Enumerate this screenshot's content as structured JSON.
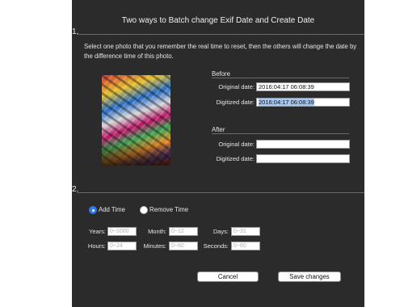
{
  "dialog": {
    "title": "Two ways to Batch change Exif Date and Create Date",
    "section1_number": "1.",
    "section2_number": "2.",
    "description": "Select one photo that you remember the real time to reset, then the others will change the date by the difference time of this photo."
  },
  "before": {
    "heading": "Before",
    "original_label": "Original date:",
    "original_value": "2016:04:17 06:08:39",
    "digitized_label": "Digitized date:",
    "digitized_value": "2016:04:17 06:08:39"
  },
  "after": {
    "heading": "After",
    "original_label": "Original date:",
    "original_value": "",
    "digitized_label": "Digitized date:",
    "digitized_value": ""
  },
  "mode": {
    "add_label": "Add Time",
    "remove_label": "Remove Time",
    "selected": "add"
  },
  "time_fields": {
    "years_label": "Years:",
    "years_placeholder": "0~1000",
    "month_label": "Month:",
    "month_placeholder": "0~12",
    "days_label": "Days:",
    "days_placeholder": "0~31",
    "hours_label": "Hours:",
    "hours_placeholder": "0~24",
    "minutes_label": "Minutes:",
    "minutes_placeholder": "0~60",
    "seconds_label": "Seconds:",
    "seconds_placeholder": "0~60"
  },
  "buttons": {
    "cancel": "Cancel",
    "save": "Save changes"
  },
  "colors": {
    "dialog_bg": "#2b2b2b",
    "radio_selected": "#2d7be5",
    "text_selection": "#a9c7ef"
  }
}
